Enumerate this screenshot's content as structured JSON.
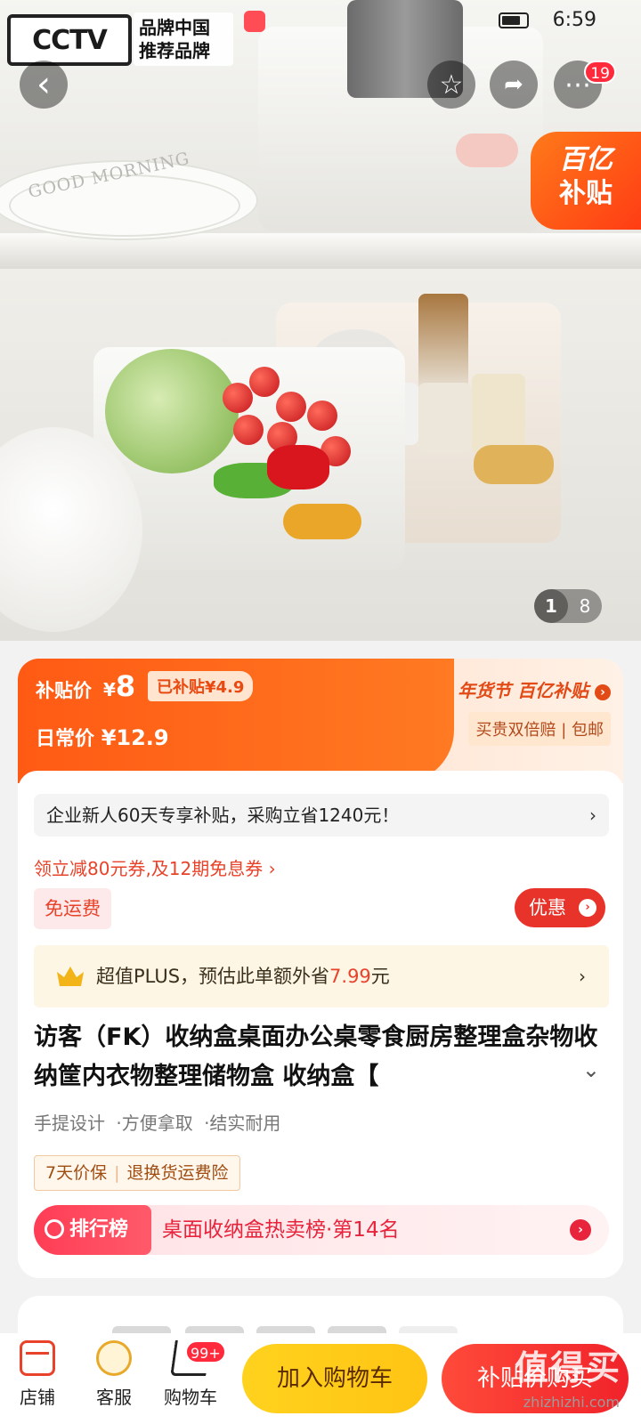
{
  "status_bar": {
    "time": "6:59",
    "overlay_logo_text": "CCTV",
    "overlay_badge_line1": "品牌中国",
    "overlay_badge_line2": "推荐品牌"
  },
  "hero": {
    "plate_text": "GOOD MORNING",
    "sticker_line1": "百亿",
    "sticker_line2": "补贴",
    "more_badge": "19",
    "pager_current": "1",
    "pager_total": "8",
    "back_glyph": "‹",
    "favorite_glyph": "☆",
    "share_glyph": "➦",
    "more_glyph": "⋯"
  },
  "price": {
    "subsidy_label": "补贴价",
    "currency": "¥",
    "subsidy_value": "8",
    "subsidy_chip": "已补贴¥4.9",
    "daily_label": "日常价",
    "daily_value": "¥12.9",
    "festival_text": "年货节 百亿补贴",
    "promise_text": "买贵双倍赔 | 包邮"
  },
  "details": {
    "enterprise_text": "企业新人60天专享补贴，采购立省1240元！",
    "coupon_text": "领立减80元券,及12期免息券 ›",
    "free_shipping": "免运费",
    "discount_label": "优惠",
    "plus_prefix": "超值PLUS，预估此单额外省",
    "plus_amount": "7.99",
    "plus_suffix": "元",
    "title": "访客（FK）收纳盒桌面办公桌零食厨房整理盒杂物收纳筐内衣物整理储物盒 收纳盒【",
    "selling_points": [
      "手提设计",
      "·方便拿取",
      "·结实耐用"
    ],
    "guarantee_1": "7天价保",
    "guarantee_2": "退换货运费险",
    "rank_tag": "排行榜",
    "rank_text": "桌面收纳盒热卖榜·第14名"
  },
  "bottom_bar": {
    "store_label": "店铺",
    "service_label": "客服",
    "cart_label": "购物车",
    "cart_badge": "99+",
    "add_to_cart": "加入购物车",
    "buy_now": "补贴价购买",
    "watermark": "值得买",
    "watermark_url": "zhizhizhi.com"
  },
  "colors": {
    "accent_orange": "#ff5a14",
    "accent_red": "#e8332a",
    "cart_yellow": "#ffd21e"
  }
}
